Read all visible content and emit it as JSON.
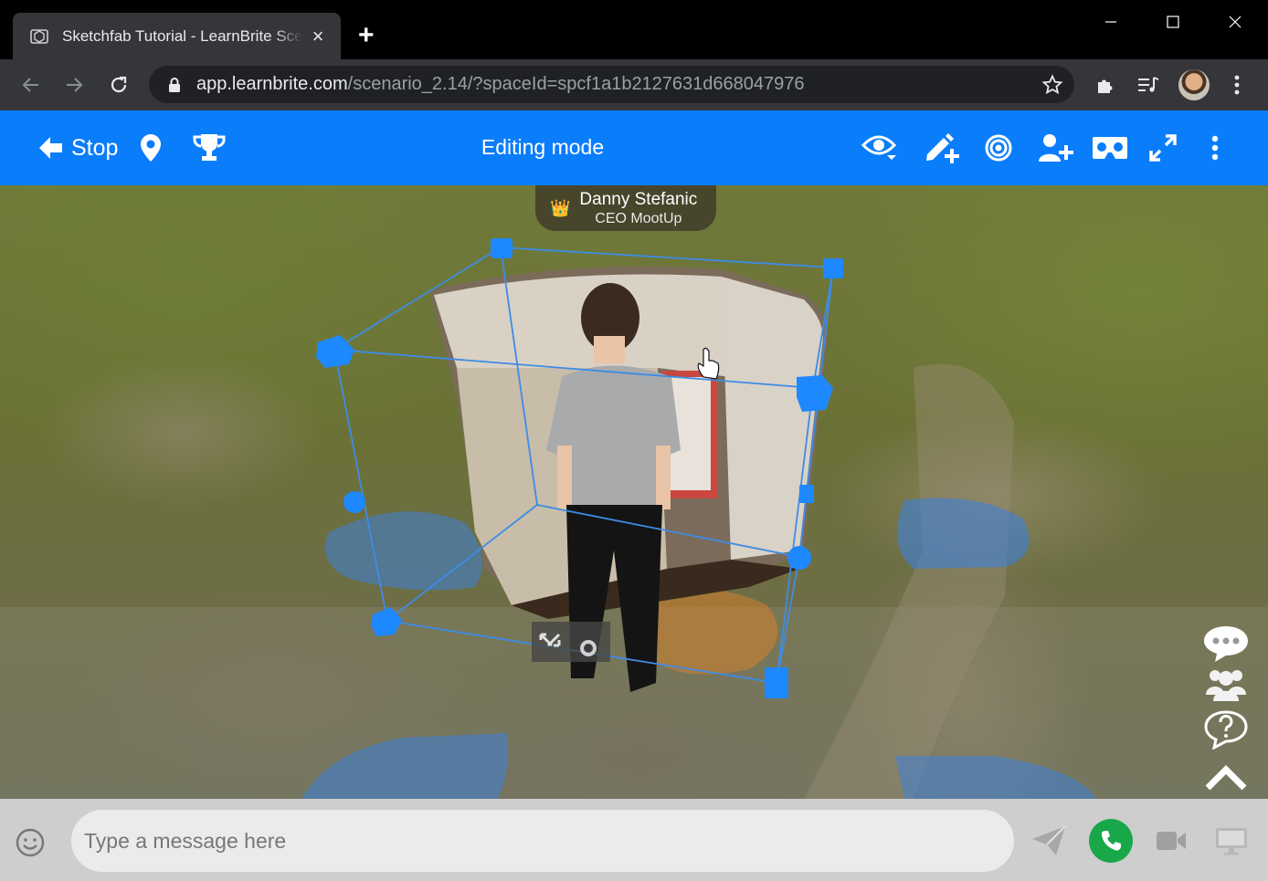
{
  "browser": {
    "tab_title": "Sketchfab Tutorial - LearnBrite Scenario",
    "new_tab_label": "+",
    "url_host": "app.learnbrite.com",
    "url_path": "/scenario_2.14/?spaceId=spcf1a1b2127631d668047976"
  },
  "header": {
    "stop_label": "Stop",
    "title": "Editing mode"
  },
  "avatar_tag": {
    "name": "Danny Stefanic",
    "subtitle": "CEO MootUp",
    "crown": "👑"
  },
  "chat": {
    "placeholder": "Type a message here"
  },
  "colors": {
    "header_blue": "#0a7dfb",
    "selection_blue": "#1e88ff",
    "call_green": "#18a849"
  }
}
